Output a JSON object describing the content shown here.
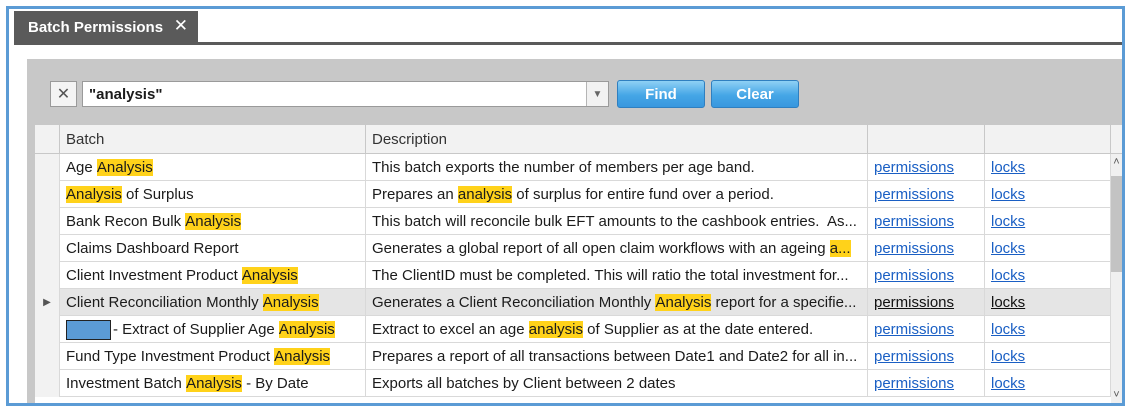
{
  "tab": {
    "title": "Batch Permissions",
    "close": "✕"
  },
  "search": {
    "clear_icon": "✕",
    "value": "\"analysis\"",
    "dropdown_icon": "▼",
    "find_label": "Find",
    "clear_label": "Clear"
  },
  "grid": {
    "headers": [
      "Batch",
      "Description",
      "",
      ""
    ],
    "rows": [
      {
        "batch": [
          [
            "Age ",
            false
          ],
          [
            "Analysis",
            true
          ]
        ],
        "desc": [
          [
            "This batch exports the number of members per age band.",
            false
          ]
        ],
        "perm": "permissions",
        "lock": "locks"
      },
      {
        "batch": [
          [
            "Analysis",
            true
          ],
          [
            " of Surplus",
            false
          ]
        ],
        "desc": [
          [
            "Prepares an ",
            false
          ],
          [
            "analysis",
            true
          ],
          [
            " of surplus for entire fund over a period.",
            false
          ]
        ],
        "perm": "permissions",
        "lock": "locks"
      },
      {
        "batch": [
          [
            "Bank Recon Bulk ",
            false
          ],
          [
            "Analysis",
            true
          ]
        ],
        "desc": [
          [
            "This batch will reconcile bulk EFT amounts to the cashbook entries.  As...",
            false
          ]
        ],
        "perm": "permissions",
        "lock": "locks"
      },
      {
        "batch": [
          [
            "Claims Dashboard Report",
            false
          ]
        ],
        "desc": [
          [
            "Generates a global report of all open claim workflows with an ageing ",
            false
          ],
          [
            "a...",
            true
          ]
        ],
        "perm": "permissions",
        "lock": "locks"
      },
      {
        "batch": [
          [
            "Client Investment Product ",
            false
          ],
          [
            "Analysis",
            true
          ]
        ],
        "desc": [
          [
            "The ClientID must be completed. This will ratio the total investment for...",
            false
          ]
        ],
        "perm": "permissions",
        "lock": "locks"
      },
      {
        "batch": [
          [
            "Client Reconciliation Monthly ",
            false
          ],
          [
            "Analysis",
            true
          ]
        ],
        "desc": [
          [
            "Generates a Client Reconciliation Monthly ",
            false
          ],
          [
            "Analysis",
            true
          ],
          [
            " report for a specifie...",
            false
          ]
        ],
        "perm": "permissions",
        "lock": "locks",
        "selected": true,
        "indicator": "▶"
      },
      {
        "batch": [
          [
            "- Extract of Supplier Age ",
            false
          ],
          [
            "Analysis",
            true
          ]
        ],
        "redacted": true,
        "desc": [
          [
            "Extract to excel an age ",
            false
          ],
          [
            "analysis",
            true
          ],
          [
            " of Supplier as at the date entered.",
            false
          ]
        ],
        "perm": "permissions",
        "lock": "locks"
      },
      {
        "batch": [
          [
            "Fund Type Investment Product ",
            false
          ],
          [
            "Analysis",
            true
          ]
        ],
        "desc": [
          [
            "Prepares a report of all transactions between Date1 and Date2 for all in...",
            false
          ]
        ],
        "perm": "permissions",
        "lock": "locks"
      },
      {
        "batch": [
          [
            "Investment Batch ",
            false
          ],
          [
            "Analysis",
            true
          ],
          [
            " - By Date",
            false
          ]
        ],
        "desc": [
          [
            "Exports all batches by Client between 2 dates",
            false
          ]
        ],
        "perm": "permissions",
        "lock": "locks"
      }
    ]
  },
  "scrollbar": {
    "up_icon": "˄",
    "down_icon": "˅"
  },
  "colors": {
    "accent": "#5b9bd5",
    "highlight": "#ffd21a",
    "link": "#1a5fc4",
    "button": "#45a6e6"
  }
}
